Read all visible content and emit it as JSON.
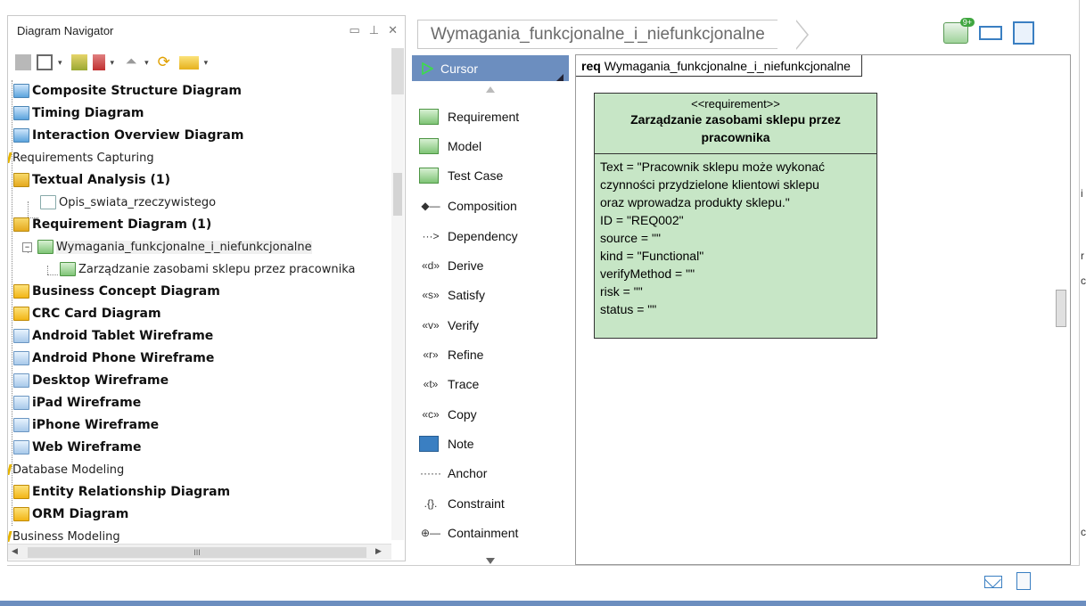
{
  "navigator": {
    "title": "Diagram Navigator",
    "header_icons": [
      "restore-icon",
      "pin-icon",
      "close-icon"
    ],
    "toolbar_icons": [
      "new-diagram-icon",
      "tree-view-icon",
      "sort-icon",
      "sort-desc-icon",
      "up-icon",
      "refresh-icon",
      "folder-icon"
    ],
    "tree": [
      {
        "label": "Composite Structure Diagram",
        "bold": true,
        "icon": "composite-icon"
      },
      {
        "label": "Timing Diagram",
        "bold": true,
        "icon": "timing-icon"
      },
      {
        "label": "Interaction Overview Diagram",
        "bold": true,
        "icon": "interaction-icon"
      },
      {
        "label": "Requirements Capturing",
        "bold": false,
        "category": true
      },
      {
        "label": "Textual Analysis (1)",
        "bold": true,
        "icon": "folder-icon"
      },
      {
        "label": "Opis_swiata_rzeczywistego",
        "bold": false,
        "icon": "doc-icon"
      },
      {
        "label": "Requirement Diagram (1)",
        "bold": true,
        "icon": "folder-icon"
      },
      {
        "label": "Wymagania_funkcjonalne_i_niefunkcjonalne",
        "bold": false,
        "icon": "requirement-diagram-icon",
        "selected": true
      },
      {
        "label": "Zarządzanie zasobami sklepu przez pracownika",
        "bold": false,
        "icon": "requirement-icon"
      },
      {
        "label": "Business Concept Diagram",
        "bold": true,
        "icon": "business-concept-icon"
      },
      {
        "label": "CRC Card Diagram",
        "bold": true,
        "icon": "crc-icon"
      },
      {
        "label": "Android Tablet Wireframe",
        "bold": true,
        "icon": "wireframe-icon"
      },
      {
        "label": "Android Phone Wireframe",
        "bold": true,
        "icon": "wireframe-icon"
      },
      {
        "label": "Desktop Wireframe",
        "bold": true,
        "icon": "wireframe-icon"
      },
      {
        "label": "iPad Wireframe",
        "bold": true,
        "icon": "wireframe-icon"
      },
      {
        "label": "iPhone Wireframe",
        "bold": true,
        "icon": "wireframe-icon"
      },
      {
        "label": "Web Wireframe",
        "bold": true,
        "icon": "wireframe-icon"
      },
      {
        "label": "Database Modeling",
        "bold": false,
        "category": true
      },
      {
        "label": "Entity Relationship Diagram",
        "bold": true,
        "icon": "erd-icon"
      },
      {
        "label": "ORM Diagram",
        "bold": true,
        "icon": "orm-icon"
      },
      {
        "label": "Business Modeling",
        "bold": false,
        "category": true
      }
    ],
    "hscroll_grip": "III"
  },
  "breadcrumb": {
    "label": "Wymagania_funkcjonalne_i_niefunkcjonalne"
  },
  "top_icons": [
    {
      "name": "notification-icon",
      "badge": "9+"
    },
    {
      "name": "fit-to-window-icon"
    },
    {
      "name": "diagram-overview-icon"
    }
  ],
  "palette": {
    "cursor": "Cursor",
    "items": [
      {
        "label": "Requirement",
        "icon": "requirement-tool-icon"
      },
      {
        "label": "Model",
        "icon": "model-tool-icon"
      },
      {
        "label": "Test Case",
        "icon": "test-case-tool-icon"
      },
      {
        "label": "Composition",
        "icon": "composition-tool-icon",
        "glyph": "◆—"
      },
      {
        "label": "Dependency",
        "icon": "dependency-tool-icon",
        "glyph": "···>"
      },
      {
        "label": "Derive",
        "icon": "derive-tool-icon",
        "glyph": "«d»"
      },
      {
        "label": "Satisfy",
        "icon": "satisfy-tool-icon",
        "glyph": "«s»"
      },
      {
        "label": "Verify",
        "icon": "verify-tool-icon",
        "glyph": "«v»"
      },
      {
        "label": "Refine",
        "icon": "refine-tool-icon",
        "glyph": "«r»"
      },
      {
        "label": "Trace",
        "icon": "trace-tool-icon",
        "glyph": "«t»"
      },
      {
        "label": "Copy",
        "icon": "copy-tool-icon",
        "glyph": "«c»"
      },
      {
        "label": "Note",
        "icon": "note-tool-icon"
      },
      {
        "label": "Anchor",
        "icon": "anchor-tool-icon",
        "glyph": "······"
      },
      {
        "label": "Constraint",
        "icon": "constraint-tool-icon",
        "glyph": ".{}."
      },
      {
        "label": "Containment",
        "icon": "containment-tool-icon",
        "glyph": "⊕—"
      }
    ]
  },
  "canvas": {
    "frame_keyword": "req",
    "frame_name": "Wymagania_funkcjonalne_i_niefunkcjonalne",
    "requirement": {
      "stereotype": "<<requirement>>",
      "name": "Zarządzanie zasobami sklepu przez pracownika",
      "properties": [
        "Text = \"Pracownik sklepu może wykonać",
        "czynności przydzielone klientowi sklepu",
        "oraz wprowadza produkty sklepu.\"",
        "ID = \"REQ002\"",
        "source = \"\"",
        "kind = \"Functional\"",
        "verifyMethod = \"\"",
        "risk = \"\"",
        "status = \"\""
      ]
    }
  },
  "edge_chars": [
    "i",
    "r",
    "c",
    "c"
  ],
  "colors": {
    "cursor_bg": "#6c8ebf",
    "requirement_fill": "#c7e6c6",
    "accent_blue": "#3a7fc2"
  }
}
